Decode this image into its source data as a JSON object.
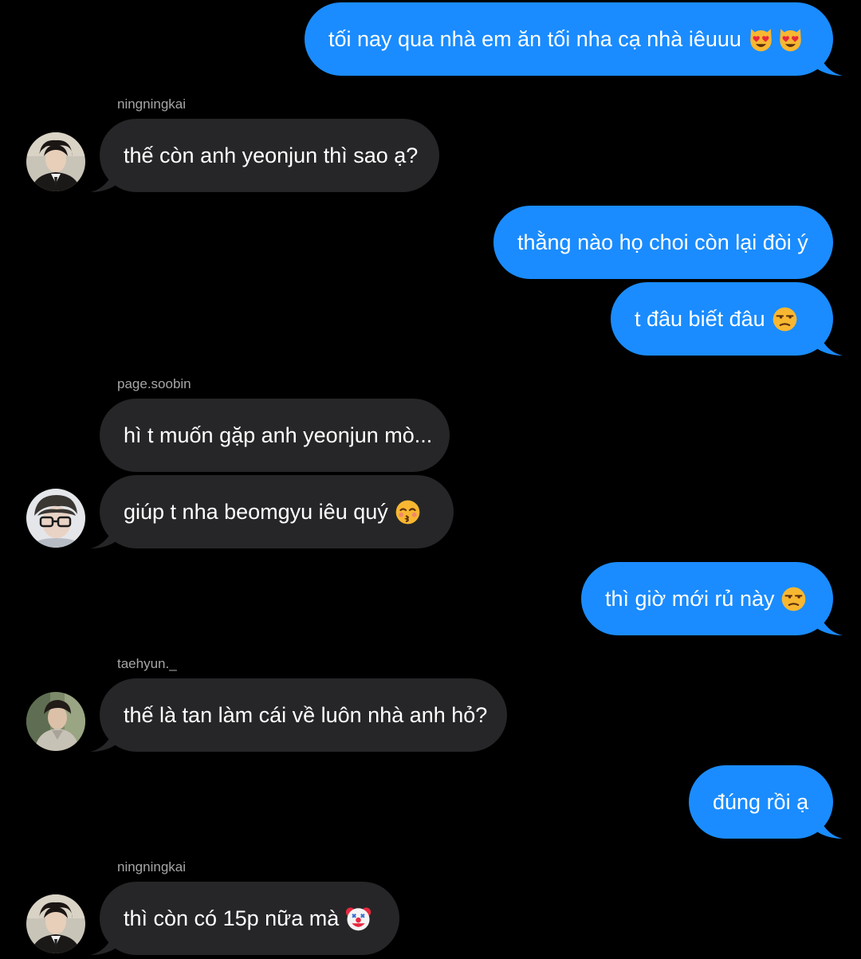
{
  "colors": {
    "background": "#000000",
    "outgoing_bubble": "#1a8cff",
    "incoming_bubble": "#262628",
    "sender_name": "#a6a6a6",
    "text": "#ffffff"
  },
  "messages": [
    {
      "direction": "outgoing",
      "text": "tối nay qua nhà em ăn tối nha cạ nhà iêuuu",
      "emojis": [
        "smiling-cat-heart-eyes-emoji",
        "smiling-cat-heart-eyes-emoji"
      ]
    },
    {
      "direction": "incoming",
      "sender": "ningningkai",
      "avatar": "ningningkai-avatar",
      "text": "thế còn anh yeonjun thì sao ạ?"
    },
    {
      "direction": "outgoing",
      "text": "thằng nào họ choi còn lại đòi ý"
    },
    {
      "direction": "outgoing",
      "text": "t đâu biết đâu",
      "emojis": [
        "unamused-face-emoji"
      ]
    },
    {
      "direction": "incoming",
      "sender": "page.soobin",
      "text": "hì t muốn gặp anh yeonjun mò..."
    },
    {
      "direction": "incoming",
      "avatar": "page-soobin-avatar",
      "text": "giúp t nha beomgyu iêu quý",
      "emojis": [
        "kissing-face-closed-eyes-emoji"
      ]
    },
    {
      "direction": "outgoing",
      "text": "thì giờ mới rủ này",
      "emojis": [
        "unamused-face-emoji"
      ]
    },
    {
      "direction": "incoming",
      "sender": "taehyun._",
      "avatar": "taehyun-avatar",
      "text": "thế là tan làm cái về luôn nhà anh hỏ?"
    },
    {
      "direction": "outgoing",
      "text": "đúng rồi ạ"
    },
    {
      "direction": "incoming",
      "sender": "ningningkai",
      "avatar": "ningningkai-avatar",
      "text": "thì còn có 15p nữa mà",
      "emojis": [
        "clown-face-emoji"
      ]
    }
  ]
}
